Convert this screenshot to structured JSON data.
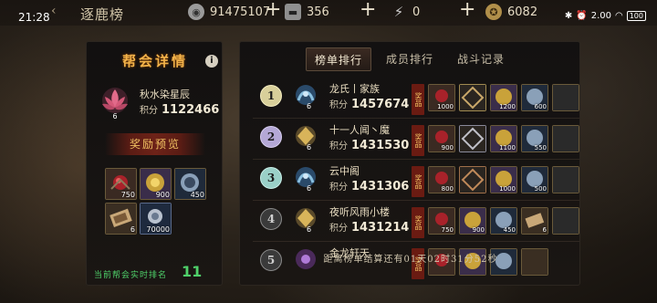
{
  "status": {
    "time": "21:28",
    "net_speed": "2.00",
    "net_unit": "KB/S",
    "battery": "100"
  },
  "header": {
    "title": "逐鹿榜"
  },
  "resources": [
    {
      "name": "silver-coin",
      "value": "91475107"
    },
    {
      "name": "ingot",
      "value": "356"
    },
    {
      "name": "energy",
      "value": "0"
    },
    {
      "name": "honor",
      "value": "6082"
    }
  ],
  "guild": {
    "panel_title": "帮会详情",
    "name": "秋水染星辰",
    "level": "6",
    "score_label": "积分",
    "score": "1122466",
    "reward_preview_title": "奖励预览",
    "rewards": [
      {
        "icon": "red-gem",
        "count": "750"
      },
      {
        "icon": "gold-ornament",
        "count": "900"
      },
      {
        "icon": "ice-medallion",
        "count": "450"
      },
      {
        "icon": "scroll",
        "count": "6"
      },
      {
        "icon": "silver-coin",
        "count": "70000"
      }
    ],
    "rank_label": "当前帮会实时排名",
    "rank": "11"
  },
  "tabs": [
    {
      "label": "榜单排行",
      "active": true
    },
    {
      "label": "成员排行",
      "active": false
    },
    {
      "label": "战斗记录",
      "active": false
    }
  ],
  "reward_tag": "奖品",
  "ranking": [
    {
      "rank": "1",
      "name": "龙氏丨家族",
      "level": "6",
      "score": "1457674",
      "rewards": [
        "1000",
        "",
        "1200",
        "600"
      ]
    },
    {
      "rank": "2",
      "name": "十一人闻丶魔",
      "level": "6",
      "score": "1431530",
      "rewards": [
        "900",
        "",
        "1100",
        "550"
      ]
    },
    {
      "rank": "3",
      "name": "云中阁",
      "level": "6",
      "score": "1431306",
      "rewards": [
        "800",
        "",
        "1000",
        "500"
      ]
    },
    {
      "rank": "4",
      "name": "夜听风雨小楼",
      "level": "6",
      "score": "1431214",
      "rewards": [
        "750",
        "900",
        "450",
        "6"
      ]
    },
    {
      "rank": "5",
      "name": "金龙轩天",
      "level": "",
      "score": "",
      "rewards": [
        "",
        "",
        "",
        ""
      ]
    }
  ],
  "countdown": "距离榜单结算还有01天02时31分52秒"
}
